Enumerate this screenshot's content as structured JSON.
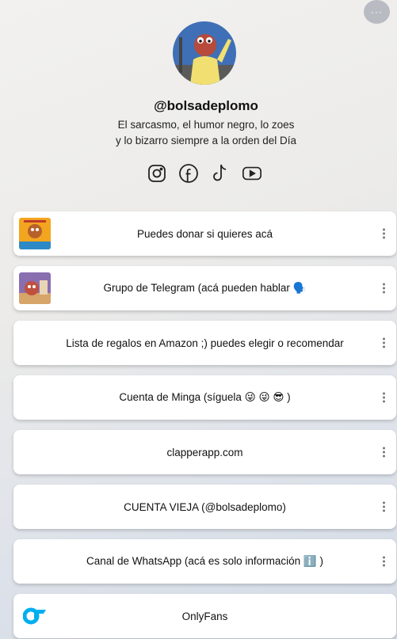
{
  "profile": {
    "username": "@bolsadeplomo",
    "bio_line1": "El sarcasmo, el humor negro, lo zoes",
    "bio_line2": "y lo bizarro siempre a la orden del Día"
  },
  "header": {
    "more_label": "···"
  },
  "socials": [
    "instagram-icon",
    "facebook-icon",
    "tiktok-icon",
    "youtube-icon"
  ],
  "links": [
    {
      "label": "Puedes donar si quieres acá",
      "thumb": "thumb-donar"
    },
    {
      "label": "Grupo de Telegram (acá pueden hablar 🗣️",
      "thumb": "thumb-telegram"
    },
    {
      "label": "Lista de regalos en Amazon ;) puedes elegir o recomendar"
    },
    {
      "label": "Cuenta de Minga (síguela 😜 😜 😎 )"
    },
    {
      "label": "clapperapp.com"
    },
    {
      "label": "CUENTA VIEJA (@bolsadeplomo)"
    },
    {
      "label": "Canal de WhatsApp (acá es solo información ℹ️ )"
    },
    {
      "label": "OnlyFans",
      "thumb": "onlyfans-icon"
    }
  ],
  "colors": {
    "button_bg": "#ffffff",
    "more_btn": "#b8bcc2",
    "onlyfans_blue": "#00aff0"
  }
}
